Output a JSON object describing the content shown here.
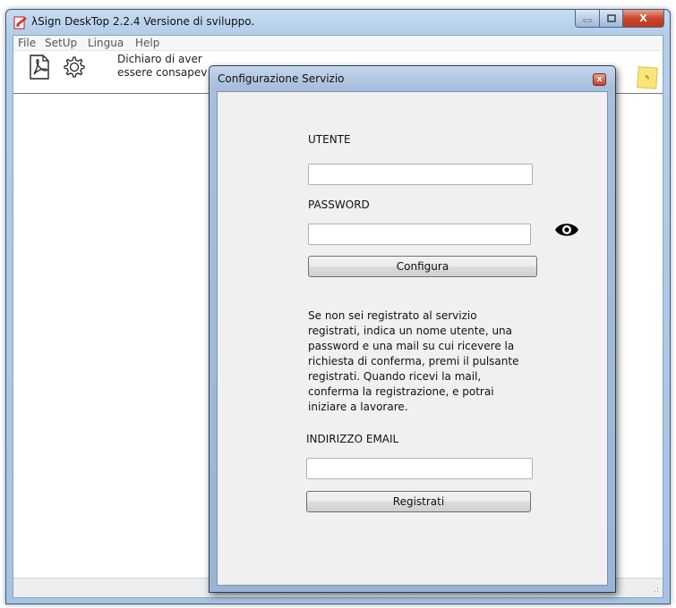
{
  "window": {
    "title": "λSign DeskTop  2.2.4 Versione di sviluppo.",
    "controls": {
      "minimize": "—",
      "maximize": "□",
      "close": "X"
    }
  },
  "menubar": {
    "items": [
      "File",
      "SetUp",
      "Lingua",
      "Help"
    ]
  },
  "toolbar": {
    "declare_line1": "Dichiaro di aver",
    "declare_line2": "essere consapev",
    "icons": [
      "pdf-icon",
      "gear-icon",
      "note-icon"
    ]
  },
  "dialog": {
    "title": "Configurazione Servizio",
    "close": "x",
    "utente_label": "UTENTE",
    "utente_value": "",
    "password_label": "PASSWORD",
    "password_value": "",
    "configura_button": "Configura",
    "info_text": "Se non sei registrato al servizio registrati, indica un nome utente, una password e una mail su cui ricevere la richiesta di conferma, premi il pulsante registrati. Quando ricevi la mail, conferma la registrazione, e potrai iniziare a lavorare.",
    "email_label": "INDIRIZZO EMAIL",
    "email_value": "",
    "registrati_button": "Registrati"
  },
  "colors": {
    "titlebar": "#b4cde9",
    "close_button": "#c8412a",
    "dialog_body": "#f0f0f0"
  }
}
